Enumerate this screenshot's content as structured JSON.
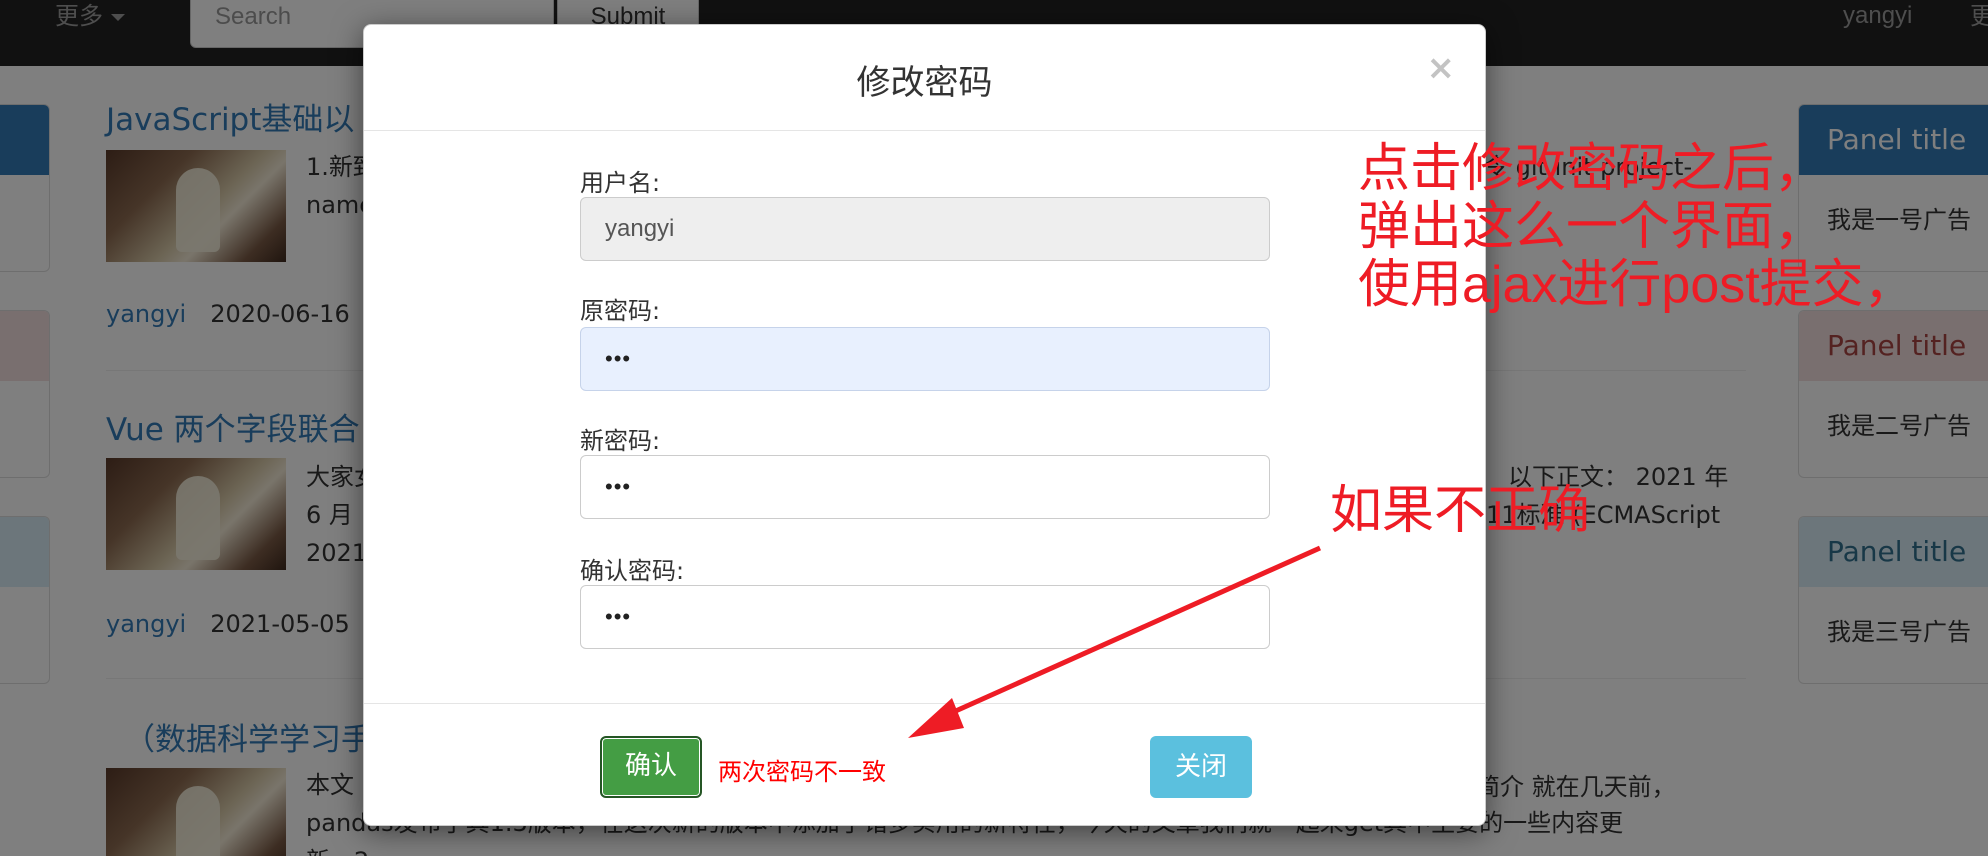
{
  "navbar": {
    "more_label": "更多",
    "search_placeholder": "Search",
    "submit_label": "Submit",
    "username": "yangyi",
    "extra": "更"
  },
  "articles": [
    {
      "title": "JavaScript基础以",
      "summary_lines": [
        "1.新致",
        "name"
      ],
      "author": "yangyi",
      "date": "2020-06-16"
    },
    {
      "title": "Vue 两个字段联合",
      "summary_lines": [
        "大家女",
        "6 月",
        "2021"
      ],
      "author": "yangyi",
      "date": "2021-05-05"
    },
    {
      "title": "（数据科学学习手",
      "summary_lines": [
        "本文",
        "pandas发布了其1.3版本，在这次新的版本中添加了诸多实用的新特性，今天的文章我们就一起来get其中主要的一些内容更",
        "新。2"
      ]
    }
  ],
  "background_right_text": {
    "git_fragment": "令 git init project-",
    "intro_fragment": "以下正文：  2021 年",
    "ecma_fragment": "11标准 (ECMAScript",
    "pandas_fragment": "简介 就在几天前，"
  },
  "panels": [
    {
      "title": "Panel title",
      "body": "我是一号广告",
      "color": "#337ab7"
    },
    {
      "title": "Panel title",
      "body": "我是二号广告",
      "color": "#f2dede"
    },
    {
      "title": "Panel title",
      "body": "我是三号广告",
      "color": "#d9edf7"
    }
  ],
  "modal": {
    "title": "修改密码",
    "close_symbol": "×",
    "fields": {
      "username": {
        "label": "用户名:",
        "value": "yangyi"
      },
      "old_password": {
        "label": "原密码:",
        "value": "•••"
      },
      "new_password": {
        "label": "新密码:",
        "value": "•••"
      },
      "confirm_password": {
        "label": "确认密码:",
        "value": "•••"
      }
    },
    "confirm_label": "确认",
    "error_message": "两次密码不一致",
    "close_label": "关闭"
  },
  "annotations": {
    "main_lines": [
      "点击修改密码之后，",
      "弹出这么一个界面，",
      "使用ajax进行post提交，"
    ],
    "second": "如果不正确",
    "color": "#ee1c25"
  }
}
